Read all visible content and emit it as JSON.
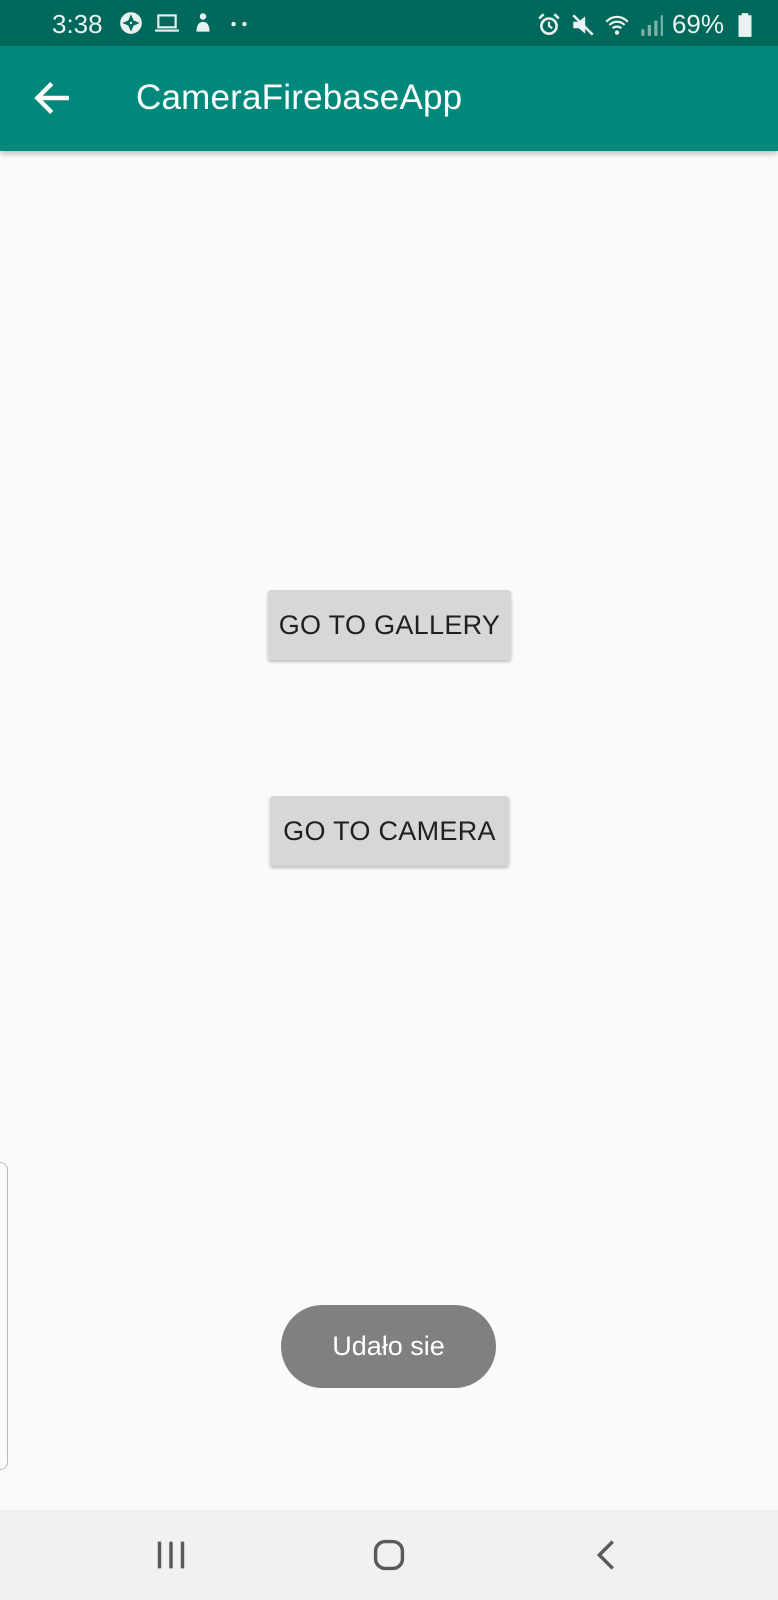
{
  "status_bar": {
    "time": "3:38",
    "battery_percent": "69%",
    "left_icons": [
      "aperture-icon",
      "laptop-icon",
      "notification-person-icon",
      "more-dots-icon"
    ],
    "right_icons": [
      "alarm-icon",
      "mute-icon",
      "wifi-icon",
      "signal-icon",
      "battery-icon"
    ],
    "battery_level": 0.69
  },
  "app_bar": {
    "title": "CameraFirebaseApp",
    "nav_icon": "back-arrow-icon"
  },
  "main": {
    "gallery_button_label": "GO TO GALLERY",
    "camera_button_label": "GO TO CAMERA"
  },
  "toast": {
    "message": "Udało sie"
  },
  "nav_bar": {
    "icons": [
      "recents-icon",
      "home-icon",
      "back-icon"
    ]
  },
  "colors": {
    "status_bar": "#00695c",
    "app_bar": "#00897b",
    "background": "#fafafa",
    "button": "#d6d7d7",
    "toast": "#808080",
    "nav_bar": "#f1f1f1"
  }
}
